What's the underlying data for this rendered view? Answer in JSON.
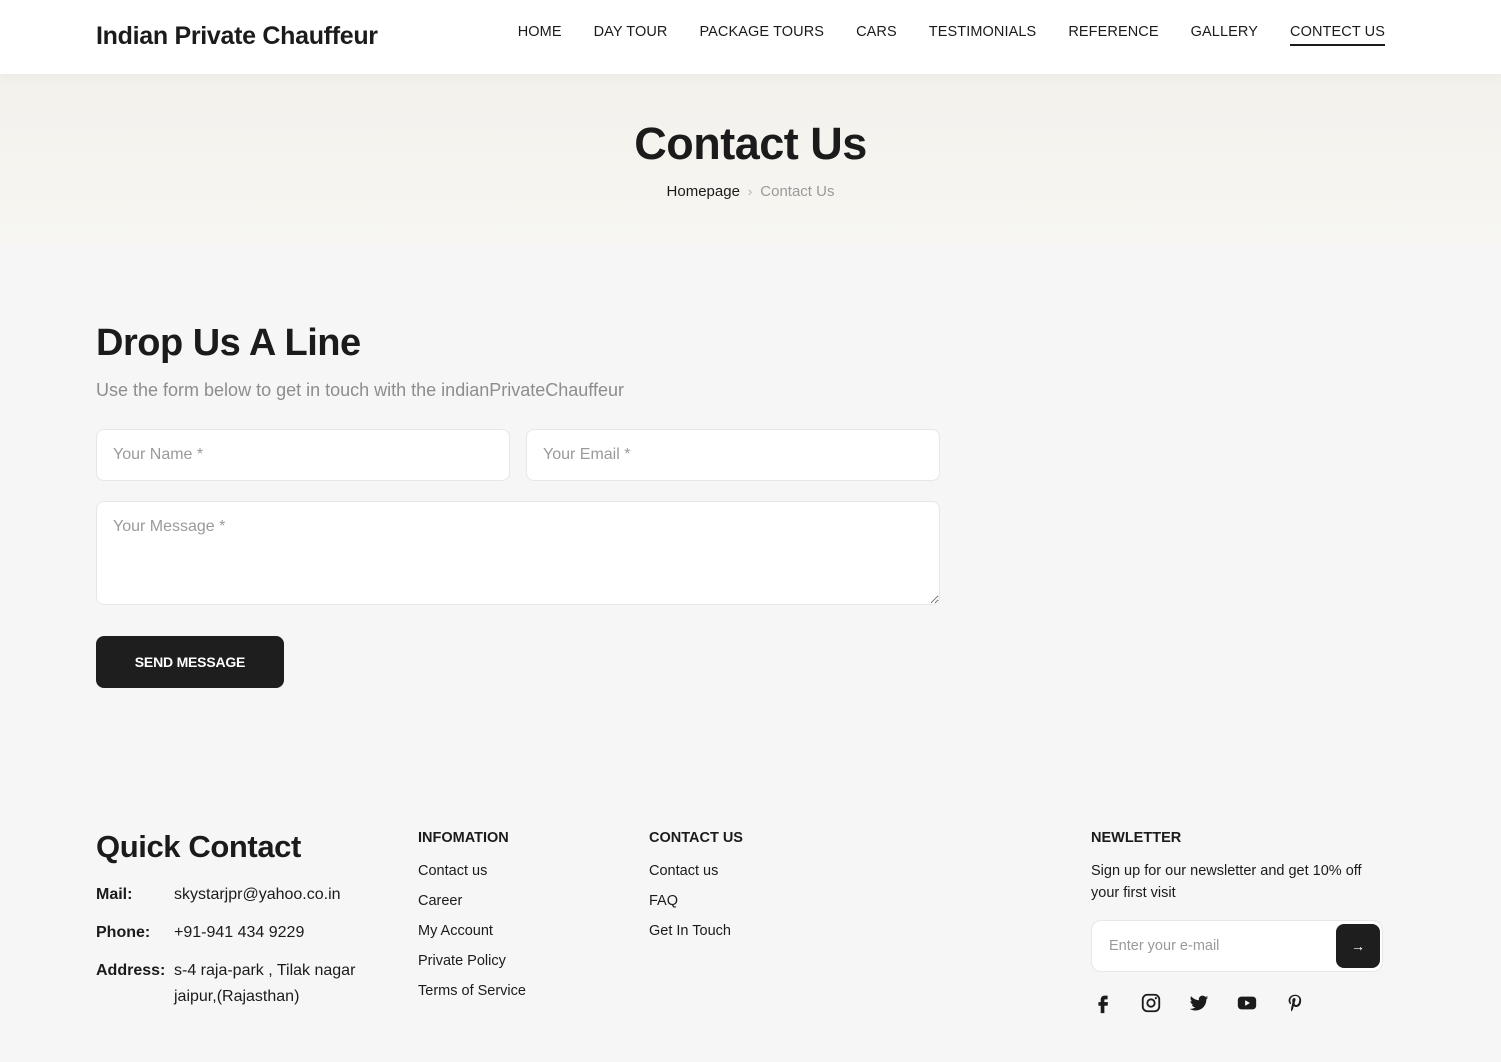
{
  "header": {
    "logo": "Indian Private Chauffeur",
    "nav": [
      "HOME",
      "DAY TOUR",
      "PACKAGE TOURS",
      "CARS",
      "TESTIMONIALS",
      "REFERENCE",
      "GALLERY",
      "CONTECT US"
    ],
    "active_nav": "CONTECT US"
  },
  "hero": {
    "title": "Contact Us",
    "breadcrumb": {
      "home": "Homepage",
      "separator": "›",
      "current": "Contact Us"
    }
  },
  "contact_form": {
    "title": "Drop Us A Line",
    "subtitle": "Use the form below to get in touch with the indianPrivateChauffeur",
    "name_placeholder": "Your Name *",
    "email_placeholder": "Your Email *",
    "message_placeholder": "Your Message *",
    "submit_label": "SEND MESSAGE"
  },
  "footer": {
    "quick_contact": {
      "title": "Quick Contact",
      "mail_label": "Mail:",
      "mail_value": "skystarjpr@yahoo.co.in",
      "phone_label": "Phone:",
      "phone_value": "+91-941 434 9229",
      "address_label": "Address:",
      "address_line1": "s-4 raja-park , Tilak nagar",
      "address_line2": "jaipur,(Rajasthan)"
    },
    "information": {
      "title": "INFOMATION",
      "items": [
        "Contact us",
        "Career",
        "My Account",
        "Private Policy",
        "Terms of Service"
      ]
    },
    "contact_us": {
      "title": "CONTACT US",
      "items": [
        "Contact us",
        "FAQ",
        "Get In Touch"
      ]
    },
    "newsletter": {
      "title": "NEWLETTER",
      "text": "Sign up for our newsletter and get 10% off your first visit",
      "placeholder": "Enter your e-mail",
      "submit_icon": "→"
    },
    "socials": [
      "facebook-icon",
      "instagram-icon",
      "twitter-icon",
      "youtube-icon",
      "pinterest-icon"
    ]
  },
  "colors": {
    "primary_dark": "#1e1e1e",
    "page_bg": "#f6f6f6",
    "hero_bg": "#f3f1ec",
    "muted_text": "#8d8d8d"
  }
}
